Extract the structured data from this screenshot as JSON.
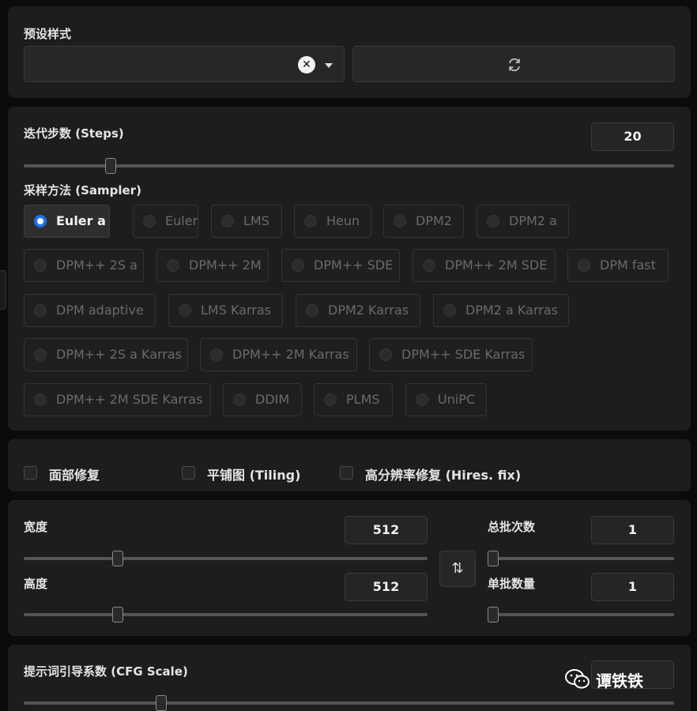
{
  "preset": {
    "label": "预设样式",
    "value": "",
    "clear_icon": "close-icon",
    "caret_icon": "chevron-down-icon",
    "refresh_icon": "refresh-icon"
  },
  "steps": {
    "label": "迭代步数 (Steps)",
    "value": "20",
    "fraction": 0.145
  },
  "sampler": {
    "label": "采样方法 (Sampler)",
    "selected": "Euler a",
    "options": [
      "Euler a",
      "Euler",
      "LMS",
      "Heun",
      "DPM2",
      "DPM2 a",
      "DPM++ 2S a",
      "DPM++ 2M",
      "DPM++ SDE",
      "DPM++ 2M SDE",
      "DPM fast",
      "DPM adaptive",
      "LMS Karras",
      "DPM2 Karras",
      "DPM2 a Karras",
      "DPM++ 2S a Karras",
      "DPM++ 2M Karras",
      "DPM++ SDE Karras",
      "DPM++ 2M SDE Karras",
      "DDIM",
      "PLMS",
      "UniPC"
    ]
  },
  "options": {
    "face_restore": "面部修复",
    "tiling": "平铺图 (Tiling)",
    "hires_fix": "高分辨率修复 (Hires. fix)"
  },
  "size": {
    "width_label": "宽度",
    "width_value": "512",
    "height_label": "高度",
    "height_value": "512",
    "swap_icon": "swap-vertical-icon"
  },
  "batch": {
    "count_label": "总批次数",
    "count_value": "1",
    "size_label": "单批数量",
    "size_value": "1"
  },
  "cfg": {
    "label": "提示词引导系数 (CFG Scale)"
  },
  "watermark": {
    "text": "谭铁铁",
    "icon": "wechat-icon"
  }
}
